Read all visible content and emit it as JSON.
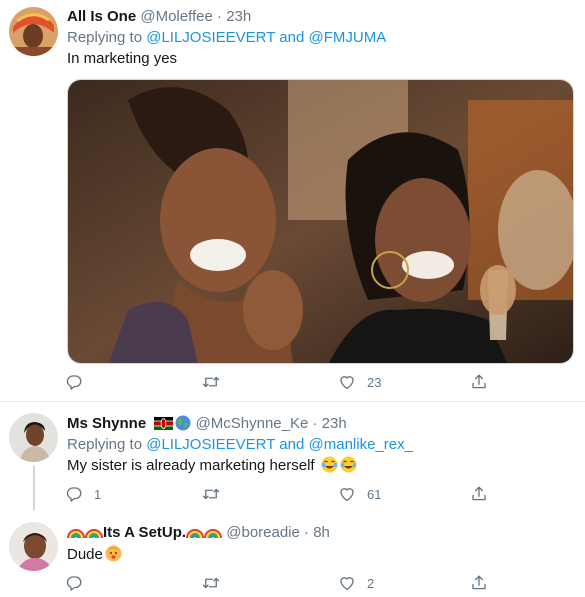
{
  "tweets": [
    {
      "name": "All Is One",
      "handle": "@Moleffee",
      "sep": "·",
      "time": "23h",
      "replying_to_prefix": "Replying to",
      "mention1": "@LILJOSIEEVERT",
      "and": "and",
      "mention2": "@FMJUMA",
      "text": "In marketing yes",
      "retweets": "",
      "likes": "23",
      "replies": ""
    },
    {
      "name": "Ms Shynne",
      "handle": "@McShynne_Ke",
      "sep": "·",
      "time": "23h",
      "replying_to_prefix": "Replying to",
      "mention1": "@LILJOSIEEVERT",
      "and": "and",
      "mention2": "@manlike_rex_",
      "text": "My sister is already marketing herself",
      "replies": "1",
      "retweets": "",
      "likes": "61"
    },
    {
      "name": "Its A SetUp.",
      "handle": "@boreadie",
      "sep": "·",
      "time": "8h",
      "text": "Dude",
      "replies": "",
      "retweets": "",
      "likes": "2"
    }
  ],
  "colors": {
    "text": "#14171a",
    "secondary": "#657786",
    "link": "#1b95e0",
    "divider": "#e6ecf0",
    "thread_line": "#ccd6dd"
  },
  "icons": [
    "reply-icon",
    "retweet-icon",
    "like-icon",
    "share-icon",
    "kenya-flag-icon",
    "globe-icon",
    "tears-of-joy-emoji",
    "rainbow-emoji",
    "face-emoji"
  ]
}
